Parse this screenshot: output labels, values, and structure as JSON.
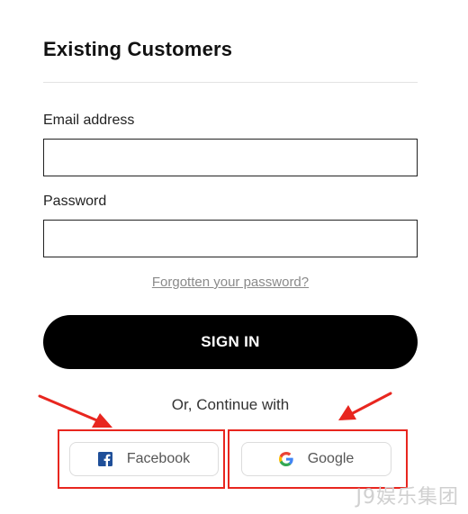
{
  "heading": "Existing Customers",
  "form": {
    "email_label": "Email address",
    "email_value": "",
    "password_label": "Password",
    "password_value": "",
    "forgot_link": "Forgotten your password?",
    "sign_in_label": "SIGN IN"
  },
  "social": {
    "continue_text": "Or, Continue with",
    "facebook_label": "Facebook",
    "google_label": "Google",
    "facebook_icon": "facebook-icon",
    "google_icon": "google-icon"
  },
  "colors": {
    "primary_button": "#000000",
    "annotation": "#e8261f",
    "facebook_blue": "#1877f2"
  },
  "watermark": "J9娱乐集团"
}
